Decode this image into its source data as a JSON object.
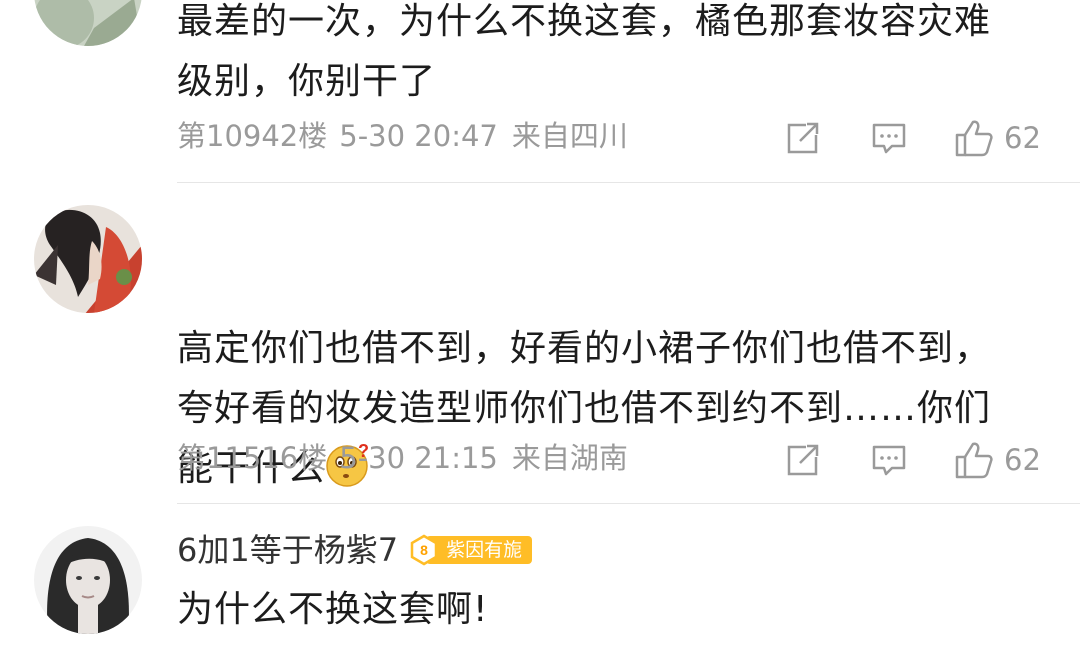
{
  "comments": [
    {
      "text": "最差的一次，为什么不换这套，橘色那套妆容灾难\n级别，你别干了",
      "floor": "第10942楼",
      "time": "5-30 20:47",
      "location": "来自四川",
      "likes": "62"
    },
    {
      "text": "高定你们也借不到，好看的小裙子你们也借不到，\n夸好看的妆发造型师你们也借不到约不到……你们\n能干什么",
      "emoji": "thinking-face",
      "floor": "第11516楼",
      "time": "5-30 21:15",
      "location": "来自湖南",
      "likes": "62"
    },
    {
      "username": "6加1等于杨紫7",
      "badge_level": "8",
      "badge_label": "紫因有旎",
      "text": "为什么不换这套啊!"
    }
  ],
  "icons": [
    "share-icon",
    "comment-icon",
    "like-icon"
  ],
  "colors": {
    "text": "#1c1c1c",
    "meta": "#9a9a9a",
    "badge": "#ffbd26",
    "divider": "#e6e6e6"
  }
}
